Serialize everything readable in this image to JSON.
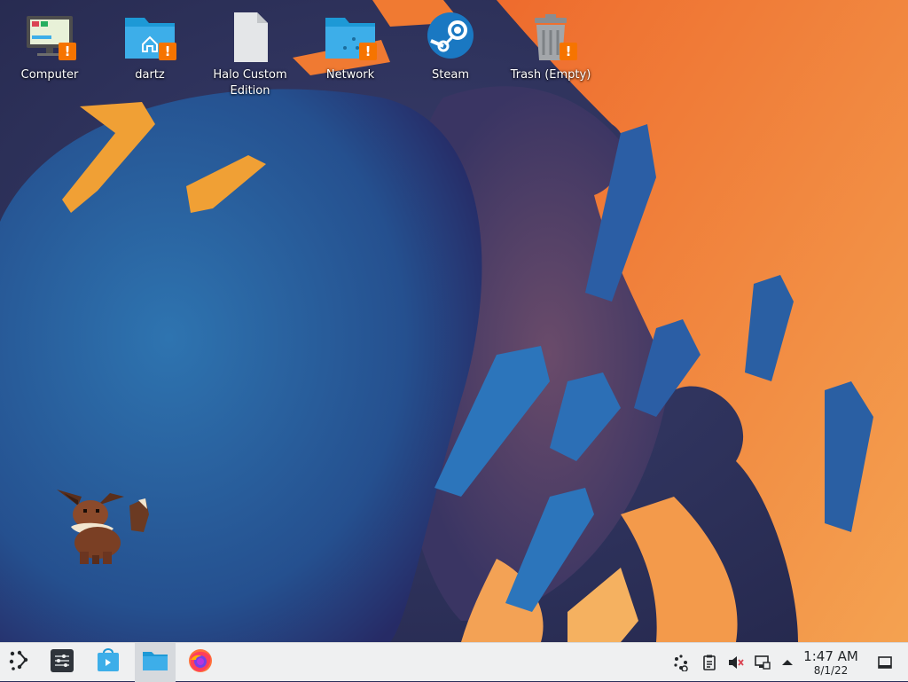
{
  "desktop": {
    "icons": [
      {
        "label": "Computer",
        "icon": "computer-icon",
        "warning": true
      },
      {
        "label": "dartz",
        "icon": "home-folder-icon",
        "warning": true
      },
      {
        "label": "Halo Custom\nEdition",
        "icon": "file-icon",
        "warning": false
      },
      {
        "label": "Network",
        "icon": "network-folder-icon",
        "warning": true
      },
      {
        "label": "Steam",
        "icon": "steam-icon",
        "warning": false
      },
      {
        "label": "Trash (Empty)",
        "icon": "trash-icon",
        "warning": true
      }
    ],
    "warning_glyph": "!"
  },
  "taskbar": {
    "launcher_icon": "kde-launcher-icon",
    "tasks": [
      {
        "name": "system-settings-icon",
        "active": false
      },
      {
        "name": "discover-icon",
        "active": false
      },
      {
        "name": "dolphin-icon",
        "active": true
      },
      {
        "name": "firefox-icon",
        "active": false
      }
    ],
    "tray": [
      "kde-connect-icon",
      "clipboard-icon",
      "volume-muted-icon",
      "network-wired-icon",
      "expand-tray-icon"
    ],
    "clock": {
      "time": "1:47 AM",
      "date": "8/1/22"
    },
    "show_desktop_icon": "show-desktop-icon"
  },
  "colors": {
    "orange": "#f08a3a",
    "blue": "#1f6fb0",
    "panel": "#eff0f1",
    "warning": "#f67400",
    "folder": "#3daee9"
  }
}
